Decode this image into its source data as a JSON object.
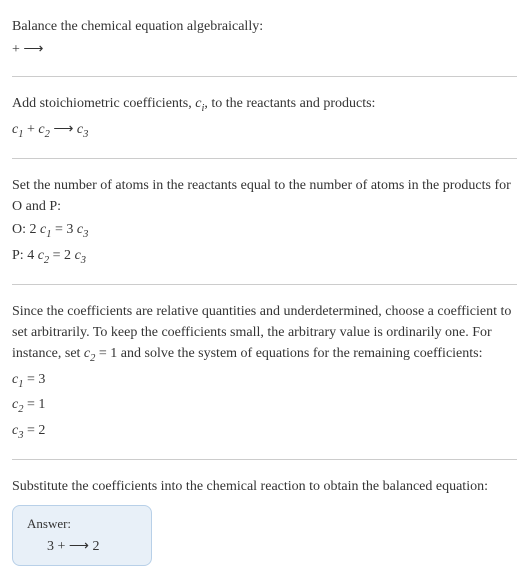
{
  "section1": {
    "title": "Balance the chemical equation algebraically:",
    "equation": " +  ⟶ "
  },
  "section2": {
    "title_part1": "Add stoichiometric coefficients, ",
    "title_ci": "c",
    "title_ci_sub": "i",
    "title_part2": ", to the reactants and products:",
    "eq_c1": "c",
    "eq_c1_sub": "1",
    "eq_plus": "  + ",
    "eq_c2": "c",
    "eq_c2_sub": "2",
    "eq_arrow": "   ⟶ ",
    "eq_c3": "c",
    "eq_c3_sub": "3"
  },
  "section3": {
    "title": "Set the number of atoms in the reactants equal to the number of atoms in the products for O and P:",
    "row_o_label": "O: ",
    "row_o_lhs_coef": "  2 ",
    "row_o_c1": "c",
    "row_o_c1_sub": "1",
    "row_o_eq": " = 3 ",
    "row_o_c3": "c",
    "row_o_c3_sub": "3",
    "row_p_label": "P: ",
    "row_p_lhs_coef": "  4 ",
    "row_p_c2": "c",
    "row_p_c2_sub": "2",
    "row_p_eq": " = 2 ",
    "row_p_c3": "c",
    "row_p_c3_sub": "3"
  },
  "section4": {
    "title_part1": "Since the coefficients are relative quantities and underdetermined, choose a coefficient to set arbitrarily. To keep the coefficients small, the arbitrary value is ordinarily one. For instance, set ",
    "set_c2": "c",
    "set_c2_sub": "2",
    "title_part2": " = 1 and solve the system of equations for the remaining coefficients:",
    "sol1_c": "c",
    "sol1_sub": "1",
    "sol1_val": " = 3",
    "sol2_c": "c",
    "sol2_sub": "2",
    "sol2_val": " = 1",
    "sol3_c": "c",
    "sol3_sub": "3",
    "sol3_val": " = 2"
  },
  "section5": {
    "title": "Substitute the coefficients into the chemical reaction to obtain the balanced equation:",
    "answer_label": "Answer:",
    "answer_content": "3  +   ⟶ 2 "
  }
}
